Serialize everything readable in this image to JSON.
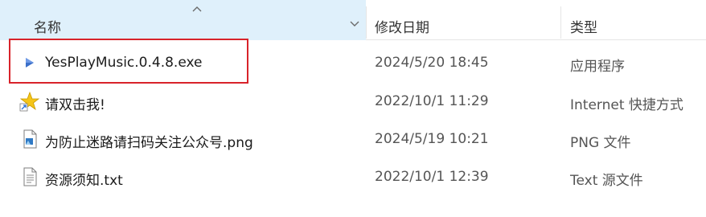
{
  "columns": {
    "name": "名称",
    "date": "修改日期",
    "type": "类型"
  },
  "files": [
    {
      "name": "YesPlayMusic.0.4.8.exe",
      "date": "2024/5/20 18:45",
      "type": "应用程序",
      "icon": "exe-file-icon"
    },
    {
      "name": "请双击我!",
      "date": "2022/10/1 11:29",
      "type": "Internet 快捷方式",
      "icon": "internet-shortcut-icon"
    },
    {
      "name": "为防止迷路请扫码关注公众号.png",
      "date": "2024/5/19 10:21",
      "type": "PNG 文件",
      "icon": "png-file-icon"
    },
    {
      "name": "资源须知.txt",
      "date": "2022/10/1 12:39",
      "type": "Text 源文件",
      "icon": "text-file-icon"
    }
  ],
  "colors": {
    "header_selected_bg": "#dff0fb",
    "highlight_border": "#d8232a"
  }
}
